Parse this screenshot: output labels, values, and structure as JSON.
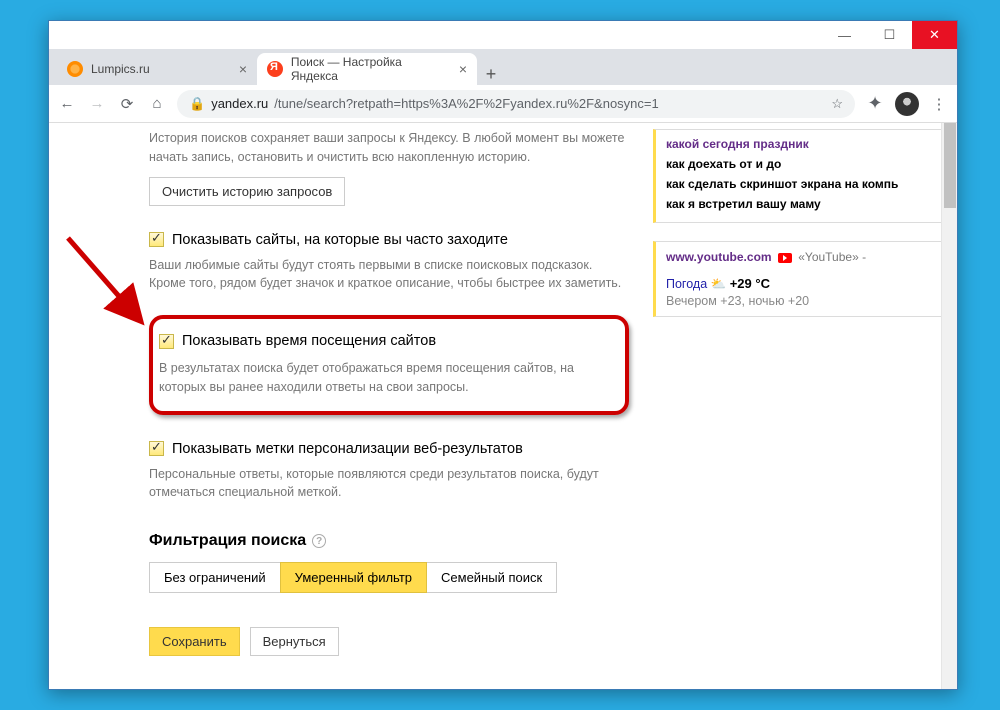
{
  "tabs": [
    {
      "title": "Lumpics.ru"
    },
    {
      "title": "Поиск — Настройка Яндекса"
    }
  ],
  "url": {
    "host": "yandex.ru",
    "path": "/tune/search?retpath=https%3A%2F%2Fyandex.ru%2F&nosync=1"
  },
  "history": {
    "desc": "История поисков сохраняет ваши запросы к Яндексу. В любой момент вы можете начать запись, остановить и очистить всю накопленную историю.",
    "clear": "Очистить историю запросов"
  },
  "opt_freq": {
    "label": "Показывать сайты, на которые вы часто заходите",
    "desc": "Ваши любимые сайты будут стоять первыми в списке поисковых подсказок. Кроме того, рядом будет значок и краткое описание, чтобы быстрее их заметить."
  },
  "opt_time": {
    "label": "Показывать время посещения сайтов",
    "desc": "В результатах поиска будет отображаться время посещения сайтов, на которых вы ранее находили ответы на свои запросы."
  },
  "opt_pers": {
    "label": "Показывать метки персонализации веб-результатов",
    "desc": "Персональные ответы, которые появляются среди результатов поиска, будут отмечаться специальной меткой."
  },
  "filter": {
    "title": "Фильтрация поиска",
    "opts": [
      "Без ограничений",
      "Умеренный фильтр",
      "Семейный поиск"
    ]
  },
  "actions": {
    "save": "Сохранить",
    "back": "Вернуться"
  },
  "suggest": [
    "какой сегодня праздник",
    "как доехать от и до",
    "как сделать скриншот экрана на компь",
    "как я встретил вашу маму"
  ],
  "side2": {
    "yt_host": "www.youtube.com",
    "yt_label": "«YouTube» -"
  },
  "weather": {
    "label": "Погода",
    "now": "+29 °C",
    "detail": "Вечером +23, ночью +20"
  }
}
